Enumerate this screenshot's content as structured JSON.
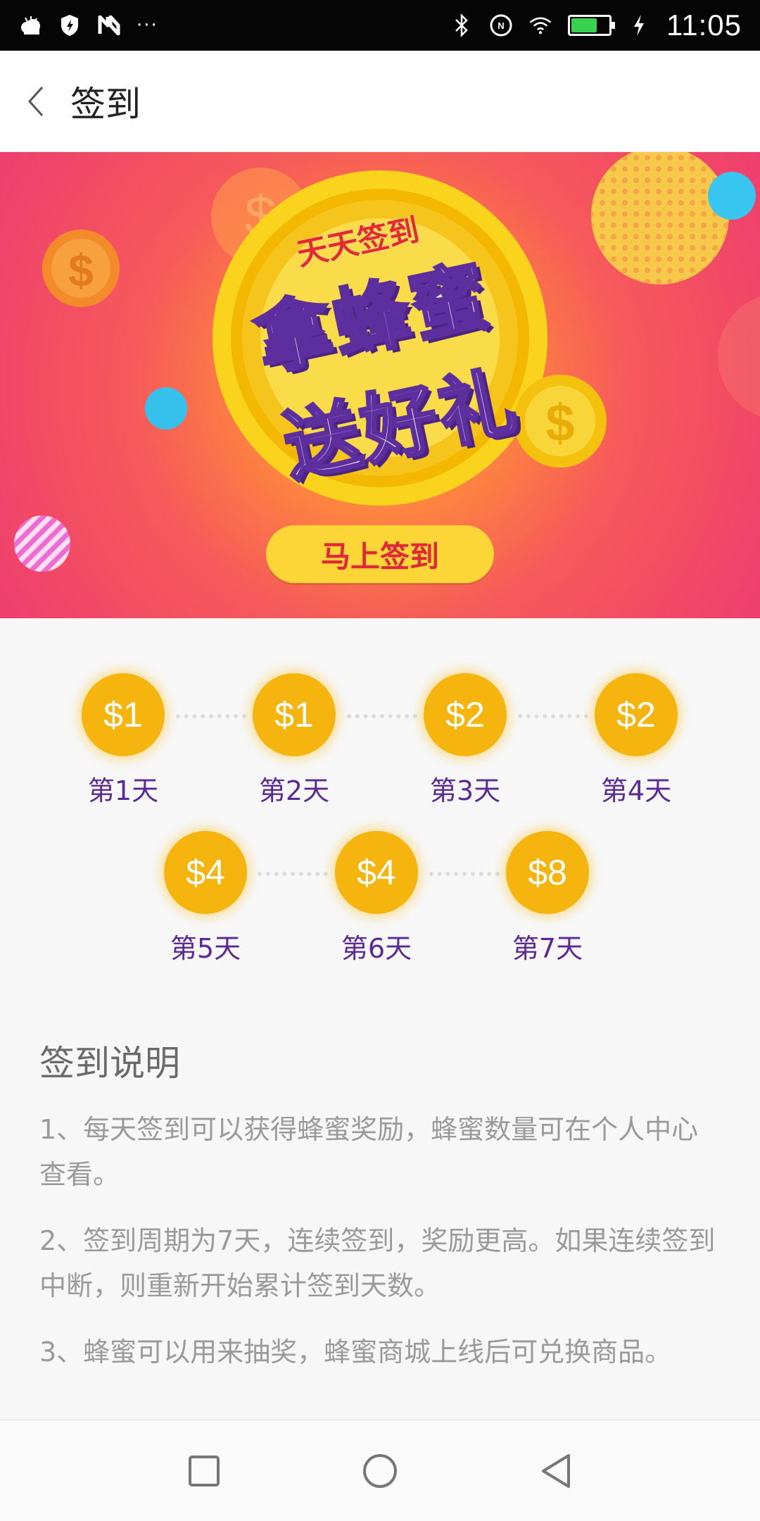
{
  "status_bar": {
    "time": "11:05",
    "battery_level": 0.7,
    "icons_left": [
      "weather-icon",
      "shield-icon",
      "n-icon",
      "more-dots-icon"
    ],
    "icons_right": [
      "bluetooth-icon",
      "nfc-icon",
      "wifi-icon",
      "battery-icon",
      "charging-icon"
    ],
    "more": "···"
  },
  "header": {
    "title": "签到"
  },
  "banner": {
    "tagline": "天天签到",
    "line1": "拿蜂蜜",
    "line2": "送好礼",
    "button_label": "马上签到"
  },
  "rewards": {
    "days": [
      {
        "amount": "$1",
        "label": "第1天"
      },
      {
        "amount": "$1",
        "label": "第2天"
      },
      {
        "amount": "$2",
        "label": "第3天"
      },
      {
        "amount": "$2",
        "label": "第4天"
      },
      {
        "amount": "$4",
        "label": "第5天"
      },
      {
        "amount": "$4",
        "label": "第6天"
      },
      {
        "amount": "$8",
        "label": "第7天"
      }
    ]
  },
  "instructions": {
    "title": "签到说明",
    "items": [
      "1、每天签到可以获得蜂蜜奖励，蜂蜜数量可在个人中心查看。",
      "2、签到周期为7天，连续签到，奖励更高。如果连续签到中断，则重新开始累计签到天数。",
      "3、蜂蜜可以用来抽奖，蜂蜜商城上线后可兑换商品。"
    ]
  },
  "colors": {
    "coin": "#f6b40f",
    "day_label": "#5a2a96",
    "button_bg": "#fcd637",
    "button_text": "#e2273a"
  }
}
